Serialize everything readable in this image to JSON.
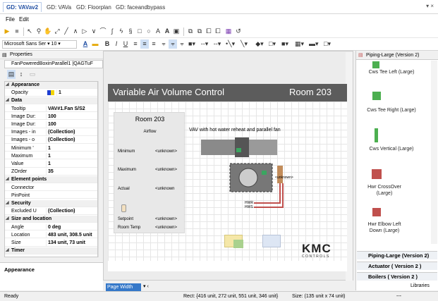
{
  "tabs": [
    "GD: VAVav2",
    "GD: VAVa",
    "GD: Floorplan",
    "GD: faceandbypass"
  ],
  "menu": [
    "File",
    "Edit"
  ],
  "font": {
    "family": "Microsoft Sans Ser",
    "size": "10"
  },
  "properties": {
    "title": "Properties",
    "object": "FanPoweredBoxinParallel1 |QAGTuF",
    "rows": [
      {
        "cat": true,
        "name": "Appearance"
      },
      {
        "name": "Opacity",
        "value": "1"
      },
      {
        "cat": true,
        "name": "Data"
      },
      {
        "name": "Tooltip",
        "value": "VAV#1.Fan S/S2"
      },
      {
        "name": "Image Dur:",
        "value": "100"
      },
      {
        "name": "Image Dur:",
        "value": "100"
      },
      {
        "name": "Images - in",
        "value": "(Collection)"
      },
      {
        "name": "Images - o",
        "value": "(Collection)"
      },
      {
        "name": "Minimum '",
        "value": "1"
      },
      {
        "name": "Maximum",
        "value": "1"
      },
      {
        "name": "Value",
        "value": "1"
      },
      {
        "name": "ZOrder",
        "value": "35"
      },
      {
        "cat": true,
        "name": "Element points"
      },
      {
        "name": "Connector",
        "value": ""
      },
      {
        "name": "PinPoint",
        "value": ""
      },
      {
        "cat": true,
        "name": "Security"
      },
      {
        "name": "Excluded U",
        "value": "(Collection)"
      },
      {
        "cat": true,
        "name": "Size and location"
      },
      {
        "name": "Angle",
        "value": "0 deg"
      },
      {
        "name": "Location",
        "value": "483 unit, 308.5 unit"
      },
      {
        "name": "Size",
        "value": "134 unit, 73 unit"
      },
      {
        "cat": true,
        "name": "Timer"
      }
    ],
    "description": "Appearance"
  },
  "canvas": {
    "title": "Variable Air Volume Control",
    "room_header": "Room 203",
    "card": {
      "room": "Room 203",
      "airflow": "Airflow",
      "rows": [
        {
          "label": "Minimum",
          "value": "<unknown>"
        },
        {
          "label": "Maximum",
          "value": "<unknown>"
        },
        {
          "label": "Actual",
          "value": "<unknown"
        },
        {
          "label": "Setpoint",
          "value": "<unknown>"
        },
        {
          "label": "Room Temp",
          "value": "<unknown>"
        }
      ]
    },
    "vav_label": "VAV with hot water reheat and parallel fan",
    "unknown_tag": "<unknown>",
    "hwr": "HWR",
    "hws": "HWS",
    "logo": "KMC",
    "logo_sub": "CONTROLS",
    "zoom": "Page Width"
  },
  "library": {
    "title": "Piping-Large (Version 2)",
    "items": [
      "Cws Tee Left (Large)",
      "Cws Tee Right (Large)",
      "Cws Vertical (Large)",
      "Hwr CrossOver (Large)",
      "Hwr Elbow Left Down (Large)"
    ],
    "sections": [
      "Piping-Large (Version 2)",
      "Actuator ( Version 2 )",
      "Boilers ( Version 2 )"
    ],
    "footer": "Libraries"
  },
  "status": {
    "ready": "Ready",
    "rect": "Rect: {416 unit, 272 unit, 551 unit, 346 unit}",
    "size": "Size: (135 unit x 74 unit)",
    "extra": "---"
  },
  "colors": {
    "accent": "#1f4ea3",
    "banner": "#5c5c5c",
    "pipe_red": "#c0504d",
    "pipe_green": "#4caf50"
  }
}
